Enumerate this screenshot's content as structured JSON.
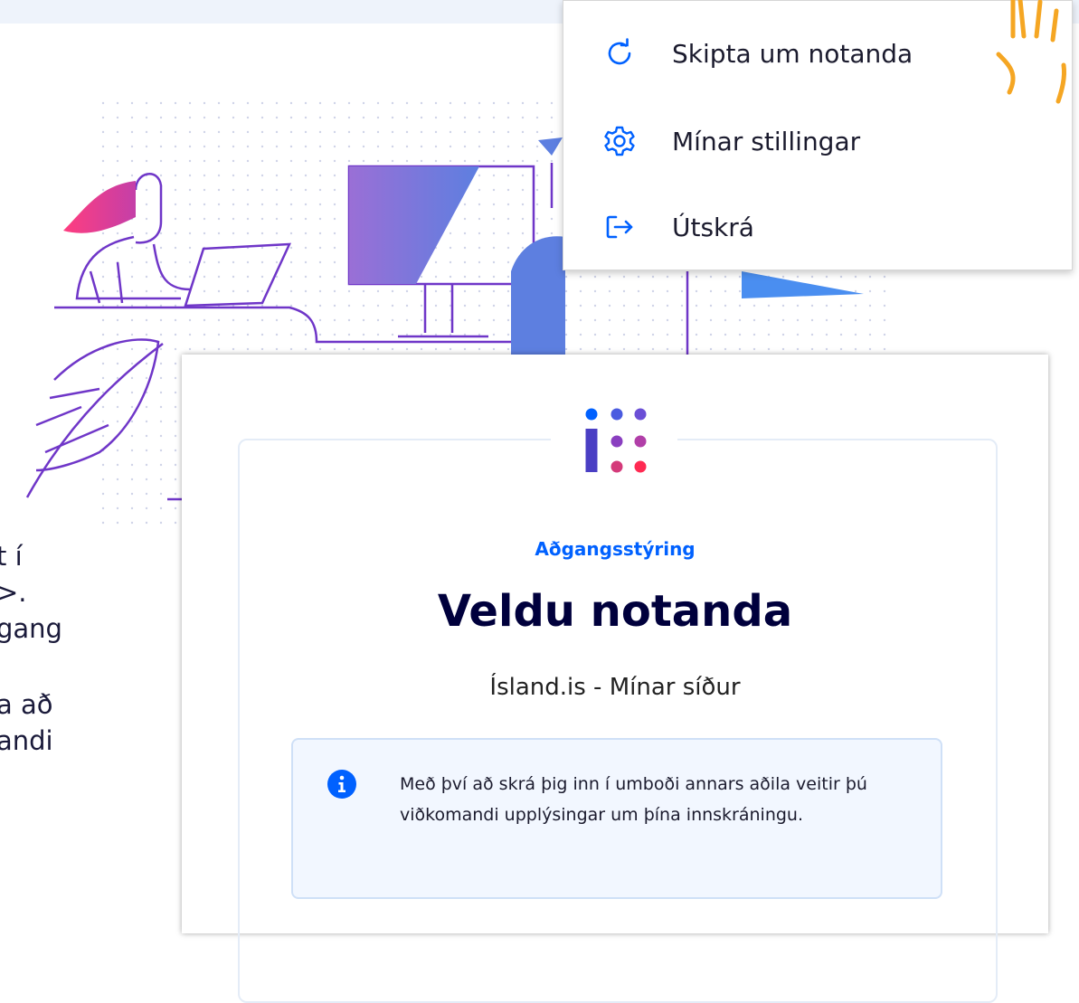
{
  "menu": {
    "items": [
      {
        "label": "Skipta um notanda",
        "icon": "refresh-icon"
      },
      {
        "label": "Mínar stillingar",
        "icon": "gear-icon"
      },
      {
        "label": "Útskrá",
        "icon": "logout-icon"
      }
    ]
  },
  "background_text": {
    "lines": [
      "t í",
      ">.",
      "gang",
      "a að",
      "andi"
    ]
  },
  "card": {
    "eyebrow": "Aðgangsstýring",
    "title": "Veldu notanda",
    "subtitle": "Ísland.is - Mínar síður",
    "info_message": "Með því að skrá þig inn í umboði annars aðila veitir þú viðkomandi upplýsingar um þína innskráningu.",
    "info_icon": "info-icon"
  },
  "colors": {
    "accent": "#0061ff",
    "title": "#00003c",
    "alert_bg": "#f2f7ff",
    "illustration_purple": "#6f36c8",
    "hand_highlight": "#f5a623"
  }
}
